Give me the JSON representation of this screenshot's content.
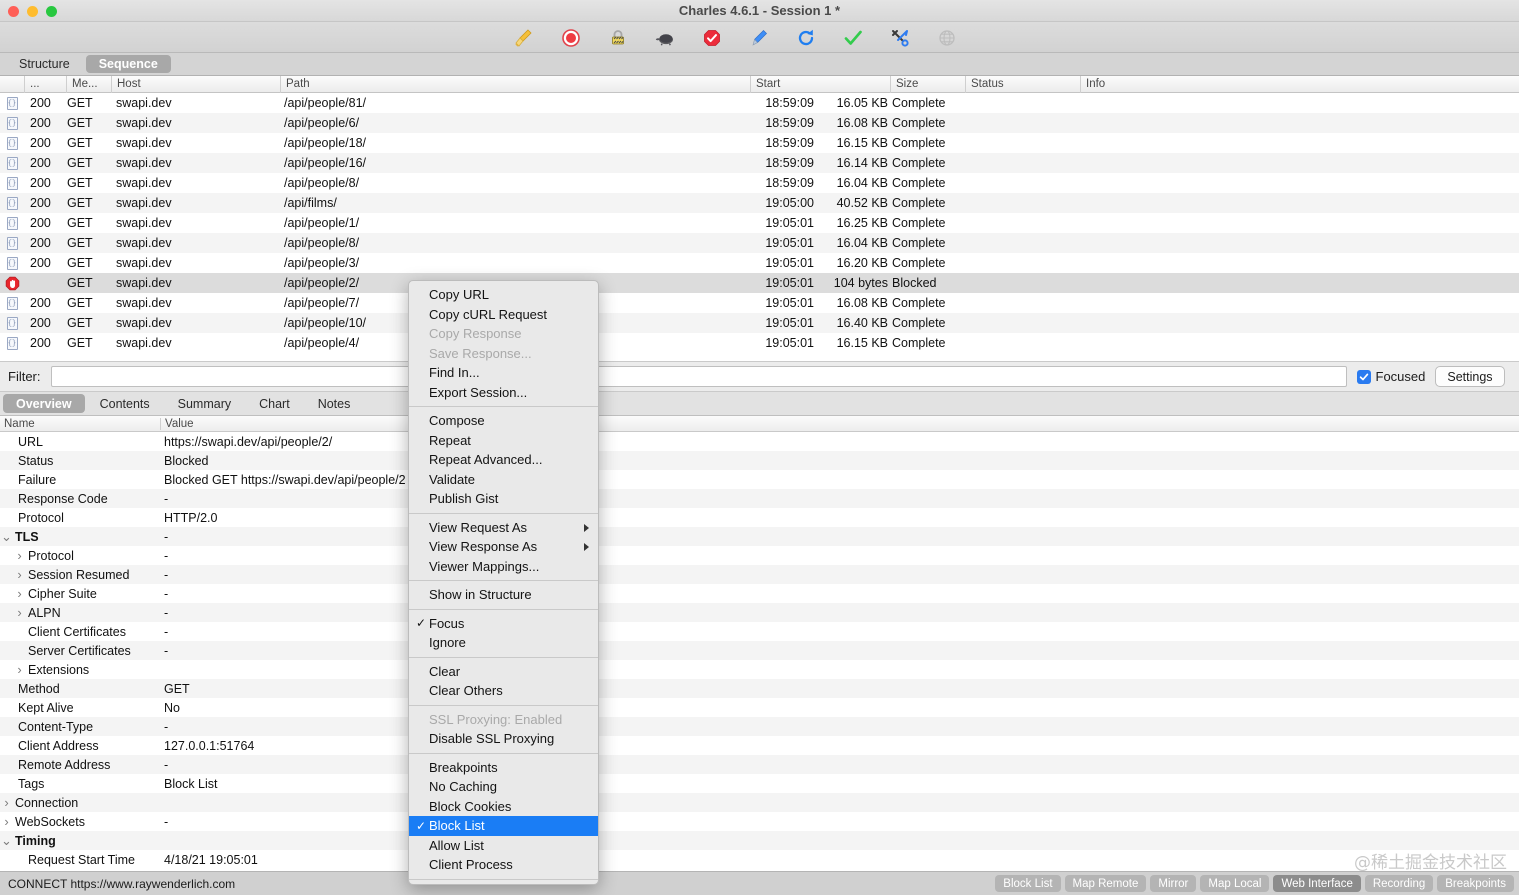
{
  "window": {
    "title": "Charles 4.6.1 - Session 1 *",
    "traffic_lights": [
      "close",
      "minimize",
      "maximize"
    ]
  },
  "toolbar": {
    "items": [
      {
        "name": "clear-broom-icon",
        "tooltip": "Clear"
      },
      {
        "name": "record-icon",
        "tooltip": "Start/Stop Recording"
      },
      {
        "name": "breakpoints-icon",
        "tooltip": "Breakpoints"
      },
      {
        "name": "throttle-turtle-icon",
        "tooltip": "Throttling"
      },
      {
        "name": "block-stop-icon",
        "tooltip": "Block"
      },
      {
        "name": "compose-pen-icon",
        "tooltip": "Compose"
      },
      {
        "name": "repeat-refresh-icon",
        "tooltip": "Repeat"
      },
      {
        "name": "validate-check-icon",
        "tooltip": "Validate"
      },
      {
        "name": "tools-icon",
        "tooltip": "Tools"
      },
      {
        "name": "web-interface-globe-icon",
        "tooltip": "Web Interface"
      }
    ]
  },
  "view_tabs": {
    "items": [
      {
        "label": "Structure",
        "active": false
      },
      {
        "label": "Sequence",
        "active": true
      }
    ]
  },
  "request_table": {
    "columns": [
      "",
      "...",
      "Me...",
      "Host",
      "Path",
      "Start",
      "Size",
      "Status",
      "Info"
    ],
    "rows": [
      {
        "icon": "json",
        "code": "200",
        "method": "GET",
        "host": "swapi.dev",
        "path": "/api/people/81/",
        "start": "18:59:09",
        "size": "16.05 KB",
        "status": "Complete",
        "info": "",
        "selected": false
      },
      {
        "icon": "json",
        "code": "200",
        "method": "GET",
        "host": "swapi.dev",
        "path": "/api/people/6/",
        "start": "18:59:09",
        "size": "16.08 KB",
        "status": "Complete",
        "info": "",
        "selected": false
      },
      {
        "icon": "json",
        "code": "200",
        "method": "GET",
        "host": "swapi.dev",
        "path": "/api/people/18/",
        "start": "18:59:09",
        "size": "16.15 KB",
        "status": "Complete",
        "info": "",
        "selected": false
      },
      {
        "icon": "json",
        "code": "200",
        "method": "GET",
        "host": "swapi.dev",
        "path": "/api/people/16/",
        "start": "18:59:09",
        "size": "16.14 KB",
        "status": "Complete",
        "info": "",
        "selected": false
      },
      {
        "icon": "json",
        "code": "200",
        "method": "GET",
        "host": "swapi.dev",
        "path": "/api/people/8/",
        "start": "18:59:09",
        "size": "16.04 KB",
        "status": "Complete",
        "info": "",
        "selected": false
      },
      {
        "icon": "json",
        "code": "200",
        "method": "GET",
        "host": "swapi.dev",
        "path": "/api/films/",
        "start": "19:05:00",
        "size": "40.52 KB",
        "status": "Complete",
        "info": "",
        "selected": false
      },
      {
        "icon": "json",
        "code": "200",
        "method": "GET",
        "host": "swapi.dev",
        "path": "/api/people/1/",
        "start": "19:05:01",
        "size": "16.25 KB",
        "status": "Complete",
        "info": "",
        "selected": false
      },
      {
        "icon": "json",
        "code": "200",
        "method": "GET",
        "host": "swapi.dev",
        "path": "/api/people/8/",
        "start": "19:05:01",
        "size": "16.04 KB",
        "status": "Complete",
        "info": "",
        "selected": false
      },
      {
        "icon": "json",
        "code": "200",
        "method": "GET",
        "host": "swapi.dev",
        "path": "/api/people/3/",
        "start": "19:05:01",
        "size": "16.20 KB",
        "status": "Complete",
        "info": "",
        "selected": false
      },
      {
        "icon": "blocked",
        "code": "",
        "method": "GET",
        "host": "swapi.dev",
        "path": "/api/people/2/",
        "start": "19:05:01",
        "size": "104 bytes",
        "status": "Blocked",
        "info": "",
        "selected": true
      },
      {
        "icon": "json",
        "code": "200",
        "method": "GET",
        "host": "swapi.dev",
        "path": "/api/people/7/",
        "start": "19:05:01",
        "size": "16.08 KB",
        "status": "Complete",
        "info": "",
        "selected": false
      },
      {
        "icon": "json",
        "code": "200",
        "method": "GET",
        "host": "swapi.dev",
        "path": "/api/people/10/",
        "start": "19:05:01",
        "size": "16.40 KB",
        "status": "Complete",
        "info": "",
        "selected": false
      },
      {
        "icon": "json",
        "code": "200",
        "method": "GET",
        "host": "swapi.dev",
        "path": "/api/people/4/",
        "start": "19:05:01",
        "size": "16.15 KB",
        "status": "Complete",
        "info": "",
        "selected": false
      }
    ]
  },
  "filter_bar": {
    "label": "Filter:",
    "value": "",
    "placeholder": "",
    "focused_label": "Focused",
    "focused_checked": true,
    "settings_label": "Settings"
  },
  "detail_tabs": {
    "items": [
      {
        "label": "Overview",
        "active": true
      },
      {
        "label": "Contents",
        "active": false
      },
      {
        "label": "Summary",
        "active": false
      },
      {
        "label": "Chart",
        "active": false
      },
      {
        "label": "Notes",
        "active": false
      }
    ]
  },
  "detail_table": {
    "columns": [
      "Name",
      "Value"
    ],
    "rows": [
      {
        "indent": 1,
        "twisty": "",
        "name": "URL",
        "value": "https://swapi.dev/api/people/2/",
        "bold": false
      },
      {
        "indent": 1,
        "twisty": "",
        "name": "Status",
        "value": "Blocked",
        "bold": false
      },
      {
        "indent": 1,
        "twisty": "",
        "name": "Failure",
        "value": "Blocked GET https://swapi.dev/api/people/2",
        "bold": false
      },
      {
        "indent": 1,
        "twisty": "",
        "name": "Response Code",
        "value": "-",
        "bold": false
      },
      {
        "indent": 1,
        "twisty": "",
        "name": "Protocol",
        "value": "HTTP/2.0",
        "bold": false
      },
      {
        "indent": 0,
        "twisty": "down",
        "name": "TLS",
        "value": "-",
        "bold": true
      },
      {
        "indent": 2,
        "twisty": "right",
        "name": "Protocol",
        "value": "-",
        "bold": false
      },
      {
        "indent": 2,
        "twisty": "right",
        "name": "Session Resumed",
        "value": "-",
        "bold": false
      },
      {
        "indent": 2,
        "twisty": "right",
        "name": "Cipher Suite",
        "value": "-",
        "bold": false
      },
      {
        "indent": 2,
        "twisty": "right",
        "name": "ALPN",
        "value": "-",
        "bold": false
      },
      {
        "indent": 2,
        "twisty": "",
        "name": "Client Certificates",
        "value": "-",
        "bold": false
      },
      {
        "indent": 2,
        "twisty": "",
        "name": "Server Certificates",
        "value": "-",
        "bold": false
      },
      {
        "indent": 2,
        "twisty": "right",
        "name": "Extensions",
        "value": "",
        "bold": false
      },
      {
        "indent": 1,
        "twisty": "",
        "name": "Method",
        "value": "GET",
        "bold": false
      },
      {
        "indent": 1,
        "twisty": "",
        "name": "Kept Alive",
        "value": "No",
        "bold": false
      },
      {
        "indent": 1,
        "twisty": "",
        "name": "Content-Type",
        "value": "-",
        "bold": false
      },
      {
        "indent": 1,
        "twisty": "",
        "name": "Client Address",
        "value": "127.0.0.1:51764",
        "bold": false
      },
      {
        "indent": 1,
        "twisty": "",
        "name": "Remote Address",
        "value": "-",
        "bold": false
      },
      {
        "indent": 1,
        "twisty": "",
        "name": "Tags",
        "value": "Block List",
        "bold": false
      },
      {
        "indent": 0,
        "twisty": "right",
        "name": "Connection",
        "value": "",
        "bold": false
      },
      {
        "indent": 0,
        "twisty": "right",
        "name": "WebSockets",
        "value": "-",
        "bold": false
      },
      {
        "indent": 0,
        "twisty": "down",
        "name": "Timing",
        "value": "",
        "bold": true
      },
      {
        "indent": 2,
        "twisty": "",
        "name": "Request Start Time",
        "value": "4/18/21 19:05:01",
        "bold": false
      }
    ]
  },
  "context_menu": {
    "groups": [
      [
        {
          "label": "Copy URL",
          "state": "normal"
        },
        {
          "label": "Copy cURL Request",
          "state": "normal"
        },
        {
          "label": "Copy Response",
          "state": "disabled"
        },
        {
          "label": "Save Response...",
          "state": "disabled"
        },
        {
          "label": "Find In...",
          "state": "normal"
        },
        {
          "label": "Export Session...",
          "state": "normal"
        }
      ],
      [
        {
          "label": "Compose",
          "state": "normal"
        },
        {
          "label": "Repeat",
          "state": "normal"
        },
        {
          "label": "Repeat Advanced...",
          "state": "normal"
        },
        {
          "label": "Validate",
          "state": "normal"
        },
        {
          "label": "Publish Gist",
          "state": "normal"
        }
      ],
      [
        {
          "label": "View Request As",
          "state": "normal",
          "submenu": true
        },
        {
          "label": "View Response As",
          "state": "normal",
          "submenu": true
        },
        {
          "label": "Viewer Mappings...",
          "state": "normal"
        }
      ],
      [
        {
          "label": "Show in Structure",
          "state": "normal"
        }
      ],
      [
        {
          "label": "Focus",
          "state": "normal",
          "checked": true
        },
        {
          "label": "Ignore",
          "state": "normal"
        }
      ],
      [
        {
          "label": "Clear",
          "state": "normal"
        },
        {
          "label": "Clear Others",
          "state": "normal"
        }
      ],
      [
        {
          "label": "SSL Proxying: Enabled",
          "state": "disabled"
        },
        {
          "label": "Disable SSL Proxying",
          "state": "normal"
        }
      ],
      [
        {
          "label": "Breakpoints",
          "state": "normal"
        },
        {
          "label": "No Caching",
          "state": "normal"
        },
        {
          "label": "Block Cookies",
          "state": "normal"
        },
        {
          "label": "Block List",
          "state": "normal",
          "checked": true,
          "highlighted": true
        },
        {
          "label": "Allow List",
          "state": "normal"
        },
        {
          "label": "Client Process",
          "state": "normal"
        }
      ]
    ]
  },
  "status_bar": {
    "text": "CONNECT https://www.raywenderlich.com",
    "buttons": [
      {
        "label": "Block List",
        "active": false
      },
      {
        "label": "Map Remote",
        "active": false
      },
      {
        "label": "Mirror",
        "active": false
      },
      {
        "label": "Map Local",
        "active": false
      },
      {
        "label": "Web Interface",
        "active": true
      },
      {
        "label": "Recording",
        "active": false
      },
      {
        "label": "Breakpoints",
        "active": false
      }
    ]
  },
  "watermark": {
    "text": "@稀土掘金技术社区"
  },
  "colors": {
    "selection_blue": "#1a7df5",
    "checkbox_blue": "#2a7bf0",
    "blocked_red": "#e8262c",
    "window_chrome": "#d4d4d4"
  }
}
